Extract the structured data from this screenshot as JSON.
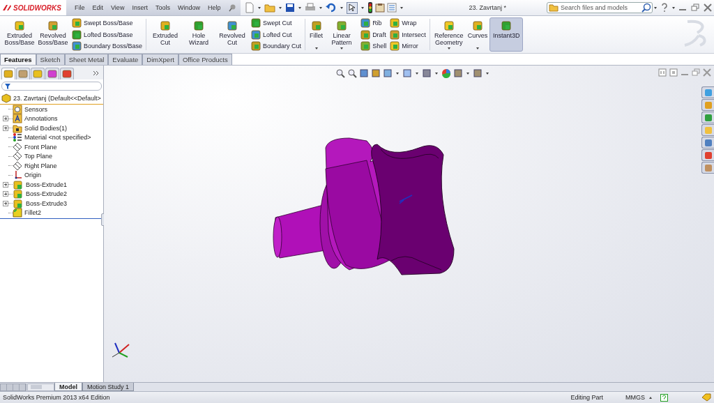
{
  "title_bar": {
    "logo": "SOLIDWORKS",
    "menu": [
      "File",
      "Edit",
      "View",
      "Insert",
      "Tools",
      "Window",
      "Help"
    ],
    "document_title": "23. Zavrtanj *",
    "search": {
      "placeholder": "Search files and models"
    }
  },
  "ribbon": [
    {
      "kind": "large",
      "items": [
        {
          "label": "Extruded Boss/Base",
          "dropdown": false,
          "selected": false
        },
        {
          "label": "Revolved Boss/Base",
          "dropdown": false,
          "selected": false
        }
      ]
    },
    {
      "kind": "stack",
      "items": [
        {
          "label": "Swept Boss/Base"
        },
        {
          "label": "Lofted Boss/Base"
        },
        {
          "label": "Boundary Boss/Base"
        }
      ]
    },
    {
      "kind": "separator"
    },
    {
      "kind": "large",
      "items": [
        {
          "label": "Extruded Cut",
          "dropdown": false,
          "selected": false
        },
        {
          "label": "Hole Wizard",
          "dropdown": false,
          "selected": false
        },
        {
          "label": "Revolved Cut",
          "dropdown": false,
          "selected": false
        }
      ]
    },
    {
      "kind": "stack",
      "items": [
        {
          "label": "Swept Cut"
        },
        {
          "label": "Lofted Cut"
        },
        {
          "label": "Boundary Cut"
        }
      ]
    },
    {
      "kind": "separator"
    },
    {
      "kind": "large",
      "items": [
        {
          "label": "Fillet",
          "dropdown": true,
          "selected": false
        },
        {
          "label": "Linear Pattern",
          "dropdown": true,
          "selected": false
        }
      ]
    },
    {
      "kind": "stack",
      "items": [
        {
          "label": "Rib"
        },
        {
          "label": "Draft"
        },
        {
          "label": "Shell"
        }
      ]
    },
    {
      "kind": "stack",
      "items": [
        {
          "label": "Wrap"
        },
        {
          "label": "Intersect"
        },
        {
          "label": "Mirror"
        }
      ]
    },
    {
      "kind": "separator"
    },
    {
      "kind": "large",
      "items": [
        {
          "label": "Reference Geometry",
          "dropdown": true,
          "selected": false
        },
        {
          "label": "Curves",
          "dropdown": true,
          "selected": false
        },
        {
          "label": "Instant3D",
          "dropdown": false,
          "selected": true
        }
      ]
    }
  ],
  "command_tabs": [
    {
      "label": "Features",
      "selected": true
    },
    {
      "label": "Sketch",
      "selected": false
    },
    {
      "label": "Sheet Metal",
      "selected": false
    },
    {
      "label": "Evaluate",
      "selected": false
    },
    {
      "label": "DimXpert",
      "selected": false
    },
    {
      "label": "Office Products",
      "selected": false
    }
  ],
  "panel_tabs": [
    {
      "selected": true
    },
    {
      "selected": false
    },
    {
      "selected": false
    },
    {
      "selected": false
    },
    {
      "selected": false
    }
  ],
  "tree": {
    "label": "23. Zavrtanj  (Default<<Default>",
    "children": [
      {
        "label": "Sensors",
        "expandable": false
      },
      {
        "label": "Annotations",
        "expandable": true
      },
      {
        "label": "Solid Bodies(1)",
        "expandable": true
      },
      {
        "label": "Material <not specified>",
        "expandable": false
      },
      {
        "label": "Front Plane",
        "expandable": false
      },
      {
        "label": "Top Plane",
        "expandable": false
      },
      {
        "label": "Right Plane",
        "expandable": false
      },
      {
        "label": "Origin",
        "expandable": false
      },
      {
        "label": "Boss-Extrude1",
        "expandable": true
      },
      {
        "label": "Boss-Extrude2",
        "expandable": true
      },
      {
        "label": "Boss-Extrude3",
        "expandable": true
      },
      {
        "label": "Fillet2",
        "expandable": false
      }
    ]
  },
  "bottom_tabs": [
    {
      "label": "Model",
      "selected": true
    },
    {
      "label": "Motion Study 1",
      "selected": false
    }
  ],
  "status_bar": {
    "edition": "SolidWorks Premium 2013 x64 Edition",
    "mode": "Editing Part",
    "units": "MMGS"
  }
}
